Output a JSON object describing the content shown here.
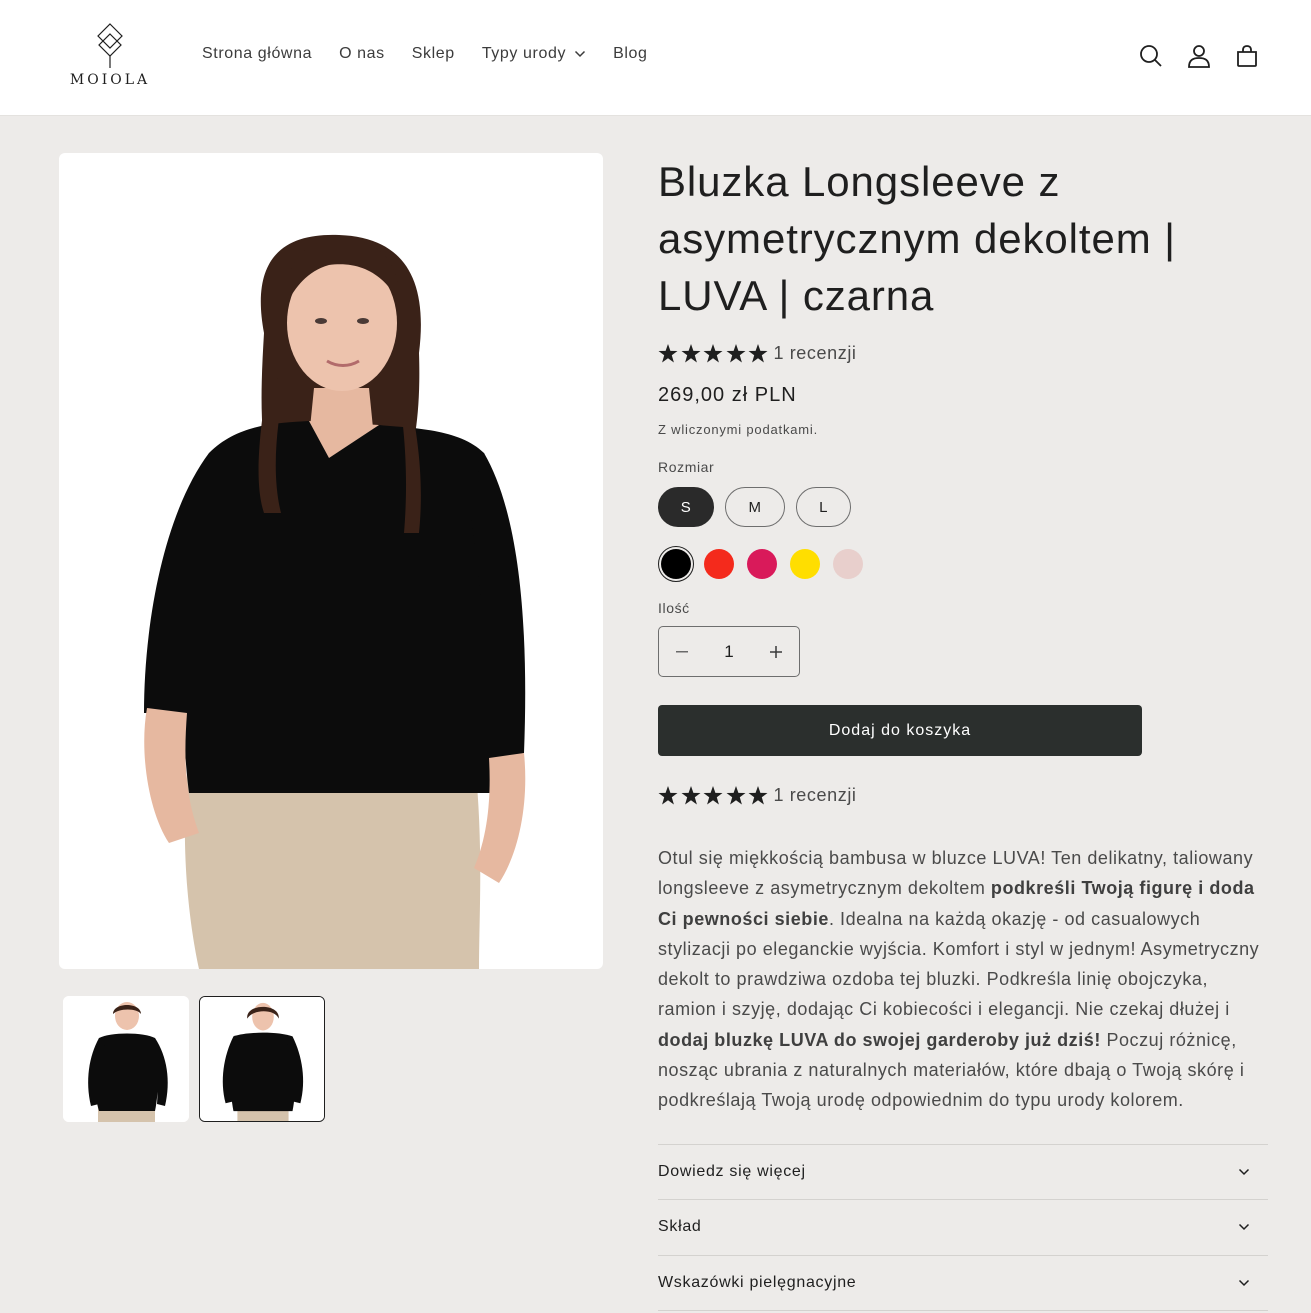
{
  "brand": {
    "name": "MOIOLA"
  },
  "nav": {
    "items": [
      {
        "label": "Strona główna"
      },
      {
        "label": "O nas"
      },
      {
        "label": "Sklep"
      },
      {
        "label": "Typy urody",
        "dropdown": true
      },
      {
        "label": "Blog"
      }
    ]
  },
  "header_icons": [
    "search-icon",
    "account-icon",
    "cart-icon"
  ],
  "product": {
    "title": "Bluzka Longsleeve z asymetrycznym dekoltem | LUVA | czarna",
    "rating": 5,
    "reviews_text": "1 recenzji",
    "price": "269,00 zł PLN",
    "tax_note": "Z wliczonymi podatkami.",
    "size_label": "Rozmiar",
    "sizes": [
      {
        "label": "S",
        "selected": true
      },
      {
        "label": "M",
        "selected": false
      },
      {
        "label": "L",
        "selected": false
      }
    ],
    "colors": [
      {
        "name": "czarna",
        "hex": "#000000",
        "selected": true
      },
      {
        "name": "czerwona",
        "hex": "#f42a1c",
        "selected": false
      },
      {
        "name": "malinowa",
        "hex": "#d91a5a",
        "selected": false
      },
      {
        "name": "żółta",
        "hex": "#ffde00",
        "selected": false
      },
      {
        "name": "pudrowa",
        "hex": "#e8cfcc",
        "selected": false
      }
    ],
    "qty_label": "Ilość",
    "quantity": "1",
    "add_to_cart": "Dodaj do koszyka",
    "description": [
      {
        "text": "Otul się miękkością bambusa w bluzce LUVA! Ten delikatny, taliowany longsleeve z asymetrycznym dekoltem ",
        "bold": false
      },
      {
        "text": "podkreśli Twoją figurę i doda Ci pewności siebie",
        "bold": true
      },
      {
        "text": ". Idealna na każdą okazję - od casualowych stylizacji po eleganckie wyjścia. Komfort i styl w jednym! Asymetryczny dekolt to prawdziwa ozdoba tej bluzki. Podkreśla linię obojczyka, ramion i szyję, dodając Ci kobiecości i elegancji. Nie czekaj dłużej i ",
        "bold": false
      },
      {
        "text": "dodaj bluzkę LUVA do swojej garderoby już dziś!",
        "bold": true
      },
      {
        "text": " Poczuj różnicę, nosząc ubrania z naturalnych materiałów, które dbają o Twoją skórę i podkreślają Twoją urodę odpowiednim do typu urody kolorem.",
        "bold": false
      }
    ],
    "accordion": [
      {
        "label": "Dowiedz się więcej"
      },
      {
        "label": "Skład"
      },
      {
        "label": "Wskazówki pielęgnacyjne"
      }
    ]
  },
  "gallery": {
    "thumbnails": [
      {
        "active": false
      },
      {
        "active": true
      }
    ]
  }
}
